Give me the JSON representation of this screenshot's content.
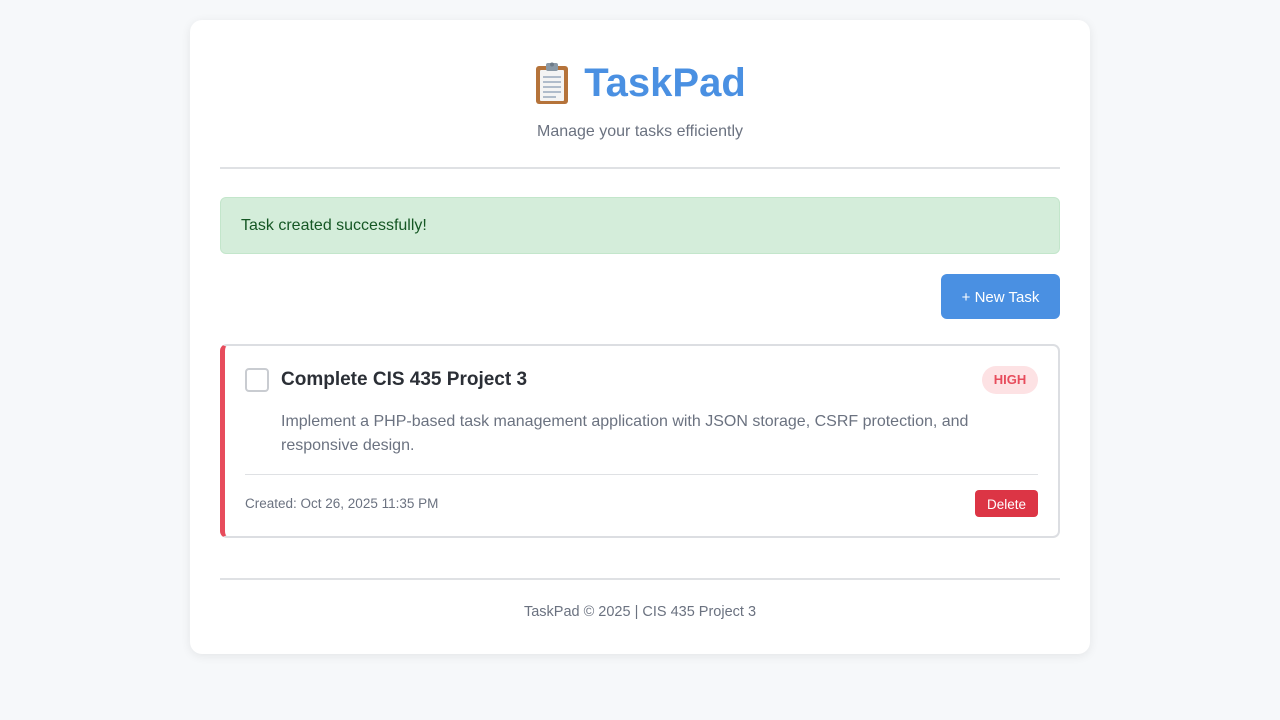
{
  "header": {
    "icon": "clipboard-icon",
    "title": "TaskPad",
    "subtitle": "Manage your tasks efficiently"
  },
  "alert": {
    "message": "Task created successfully!"
  },
  "toolbar": {
    "new_task_label": "+ New Task"
  },
  "tasks": [
    {
      "title": "Complete CIS 435 Project 3",
      "priority": "HIGH",
      "description": "Implement a PHP-based task management application with JSON storage, CSRF protection, and responsive design.",
      "created": "Created: Oct 26, 2025 11:35 PM",
      "completed": false,
      "delete_label": "Delete"
    }
  ],
  "footer": {
    "text": "TaskPad © 2025 | CIS 435 Project 3"
  },
  "colors": {
    "accent": "#4a90e2",
    "high_priority": "#e74c5c",
    "delete": "#dc3545",
    "success_bg": "#d4edda",
    "success_text": "#155724"
  }
}
